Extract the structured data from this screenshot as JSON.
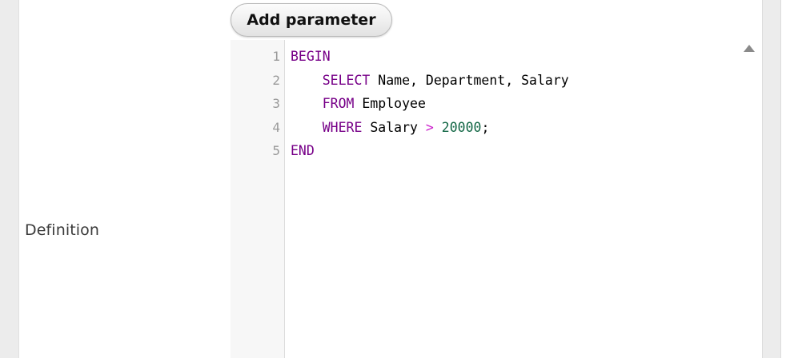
{
  "form": {
    "add_parameter_label": "Add parameter",
    "definition_label": "Definition"
  },
  "editor": {
    "line_numbers": [
      "1",
      "2",
      "3",
      "4",
      "5"
    ],
    "lines": [
      {
        "indent": "",
        "keyword": "BEGIN",
        "text": "",
        "operator": "",
        "number": "",
        "tail": ""
      },
      {
        "indent": "    ",
        "keyword": "SELECT",
        "text": " Name, Department, Salary",
        "operator": "",
        "number": "",
        "tail": ""
      },
      {
        "indent": "    ",
        "keyword": "FROM",
        "text": " Employee",
        "operator": "",
        "number": "",
        "tail": ""
      },
      {
        "indent": "    ",
        "keyword": "WHERE",
        "text": " Salary ",
        "operator": ">",
        "number": " 20000",
        "tail": ";"
      },
      {
        "indent": "",
        "keyword": "END",
        "text": "",
        "operator": "",
        "number": "",
        "tail": ""
      }
    ],
    "syntax_colors": {
      "keyword": "#770088",
      "operator": "#cc22cc",
      "number": "#116644",
      "line_number": "#999999"
    }
  },
  "icons": {
    "scroll_up": "triangle-up-icon"
  }
}
